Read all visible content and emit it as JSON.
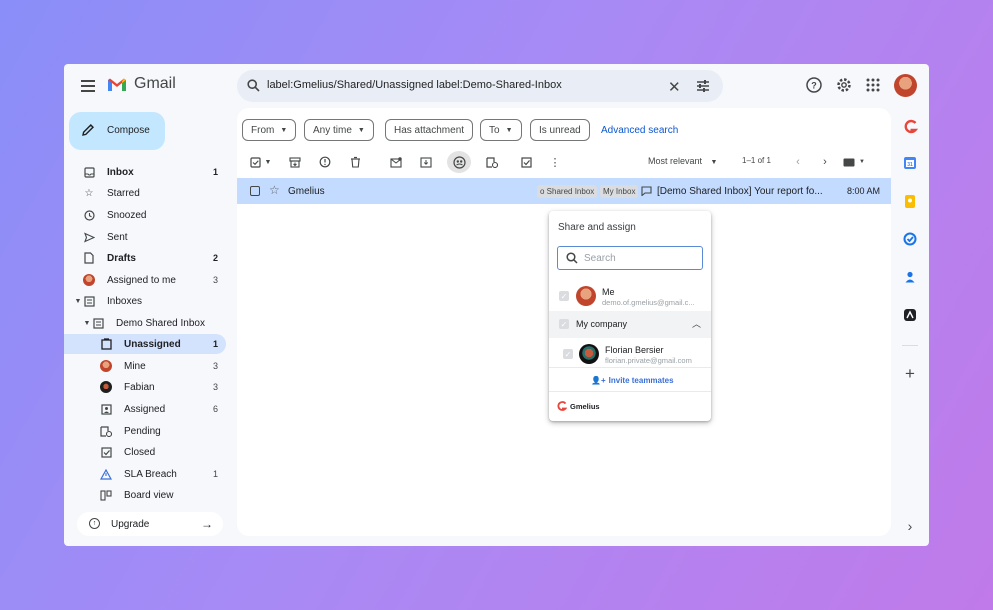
{
  "app": {
    "name": "Gmail"
  },
  "search": {
    "query": "label:Gmelius/Shared/Unassigned label:Demo-Shared-Inbox"
  },
  "compose": {
    "label": "Compose"
  },
  "nav": {
    "items": [
      {
        "label": "Inbox",
        "count": "1"
      },
      {
        "label": "Starred",
        "count": ""
      },
      {
        "label": "Snoozed",
        "count": ""
      },
      {
        "label": "Sent",
        "count": ""
      },
      {
        "label": "Drafts",
        "count": "2"
      },
      {
        "label": "Assigned to me",
        "count": "3"
      },
      {
        "label": "Inboxes",
        "count": ""
      },
      {
        "label": "Demo Shared Inbox",
        "count": ""
      },
      {
        "label": "Unassigned",
        "count": "1"
      },
      {
        "label": "Mine",
        "count": "3"
      },
      {
        "label": "Fabian",
        "count": "3"
      },
      {
        "label": "Assigned",
        "count": "6"
      },
      {
        "label": "Pending",
        "count": ""
      },
      {
        "label": "Closed",
        "count": ""
      },
      {
        "label": "SLA Breach",
        "count": "1"
      },
      {
        "label": "Board view",
        "count": ""
      }
    ],
    "upgrade": "Upgrade"
  },
  "filters": {
    "chips": [
      "From",
      "Any time",
      "Has attachment",
      "To",
      "Is unread"
    ],
    "advanced": "Advanced search"
  },
  "toolbar": {
    "sort": "Most relevant",
    "pager": "1–1 of 1"
  },
  "email": {
    "sender": "Gmelius",
    "labels": [
      "o Shared Inbox",
      "My Inbox"
    ],
    "subject": "[Demo Shared Inbox] Your report fo...",
    "time": "8:00 AM"
  },
  "popup": {
    "title": "Share and assign",
    "search_placeholder": "Search",
    "me": {
      "name": "Me",
      "email": "demo.of.gmelius@gmail.c..."
    },
    "company": "My company",
    "member": {
      "name": "Florian Bersier",
      "email": "florian.private@gmail.com"
    },
    "invite": "Invite teammates",
    "brand": "Gmelius"
  },
  "colors": {
    "accent": "#0b57d0",
    "compose": "#c2e7ff",
    "selected_row": "#c2dbff",
    "active_nav": "#d3e3fd"
  }
}
